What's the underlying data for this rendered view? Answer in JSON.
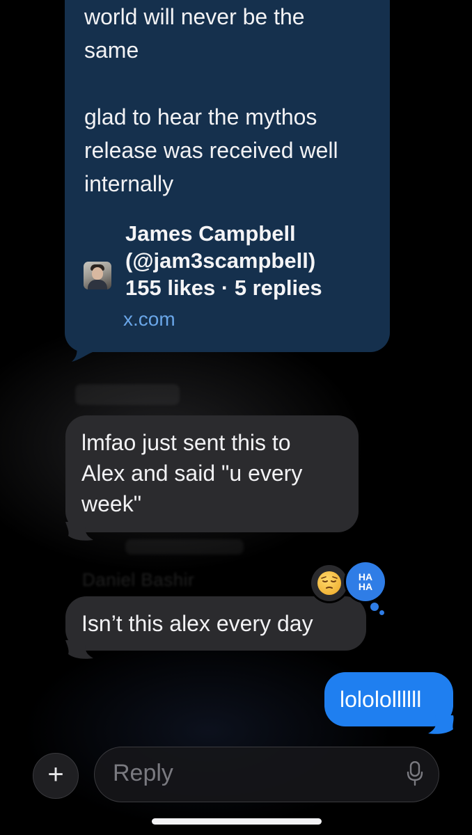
{
  "thread": {
    "link_message": {
      "text_part1": "world will never be the\nsame",
      "text_part2": "glad to hear the mythos\nrelease was received well\ninternally",
      "preview_title": "James Campbell\n(@jam3scampbell)\n155 likes · 5 replies",
      "preview_domain": "x.com"
    },
    "received_1": {
      "text": "lmfao just sent this to\nAlex and said \"u every\nweek\""
    },
    "received_2": {
      "sender_ghost": "Daniel Bashir",
      "text": "Isn’t this alex every day",
      "reactions": {
        "emoji": "pensive-face-emoji",
        "tapback_line1": "HA",
        "tapback_line2": "HA"
      }
    },
    "sent_1": {
      "text": "lololollllll"
    }
  },
  "composer": {
    "plus_label": "+",
    "placeholder": "Reply"
  },
  "colors": {
    "sent_bubble": "#1f7ff0",
    "received_bubble": "#2b2b2e",
    "link_bubble": "#15304d",
    "link_domain": "#6aa6e8"
  }
}
